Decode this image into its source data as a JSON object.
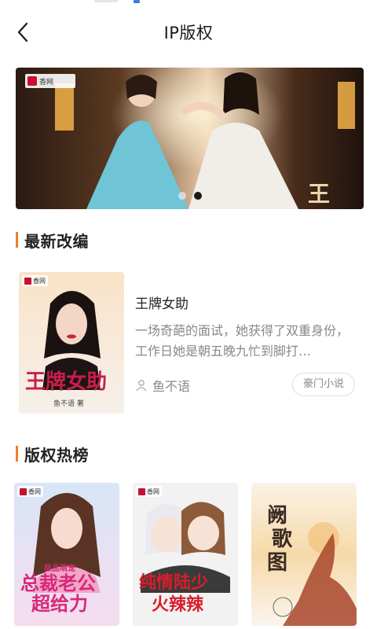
{
  "header": {
    "title": "IP版权",
    "back_icon": "chevron-left-icon"
  },
  "banner": {
    "logo_text": "香网",
    "overlay_title": "王妃",
    "dots": [
      {
        "active": false
      },
      {
        "active": true
      }
    ]
  },
  "sections": {
    "latest_adaptation": "最新改编",
    "copyright_ranking": "版权热榜"
  },
  "featured_book": {
    "title": "王牌女助",
    "description": "一场奇葩的面试，她获得了双重身份，工作日她是朝五晚九忙到脚打…",
    "author": "鱼不语",
    "tag": "豪门小说",
    "cover_logo": "香网",
    "cover_title": "王牌女助",
    "cover_author": "鱼不语 著"
  },
  "hot_books": [
    {
      "cover_logo": "香网",
      "cover_title": "总裁老公超给力",
      "cover_subtitle": "极品萌宠"
    },
    {
      "cover_logo": "香网",
      "cover_title": "纯情陆少火辣辣"
    },
    {
      "cover_logo": "",
      "cover_title": "阙歌图"
    }
  ],
  "colors": {
    "accent": "#f07d2d",
    "brand_red": "#c8102e",
    "text_primary": "#222222",
    "text_secondary": "#888888"
  }
}
